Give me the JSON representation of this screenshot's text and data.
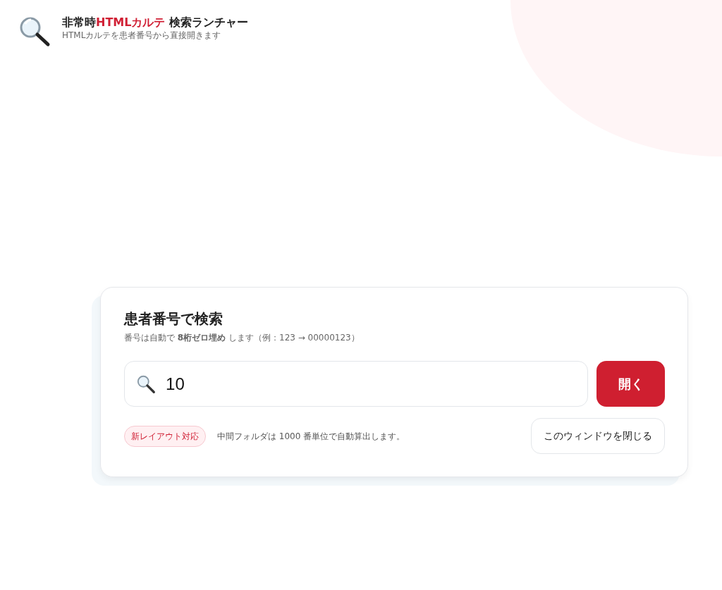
{
  "header": {
    "title_parts": [
      {
        "text": "非常時",
        "accent": false
      },
      {
        "text": "HTMLカルテ",
        "accent": true
      },
      {
        "text": " 検索ランチャー",
        "accent": false
      }
    ],
    "subtitle": "HTMLカルテを患者番号から直接開きます"
  },
  "card": {
    "title": "患者番号で検索",
    "hint": "番号は自動で **8桁ゼロ埋め** します（例：123 → 00000123）",
    "search": {
      "value": "10"
    },
    "open_button": "開く",
    "badge": "新レイアウト対応",
    "note": "中間フォルダは 1000 番単位で自動算出します。",
    "close_button": "このウィンドウを閉じる"
  }
}
